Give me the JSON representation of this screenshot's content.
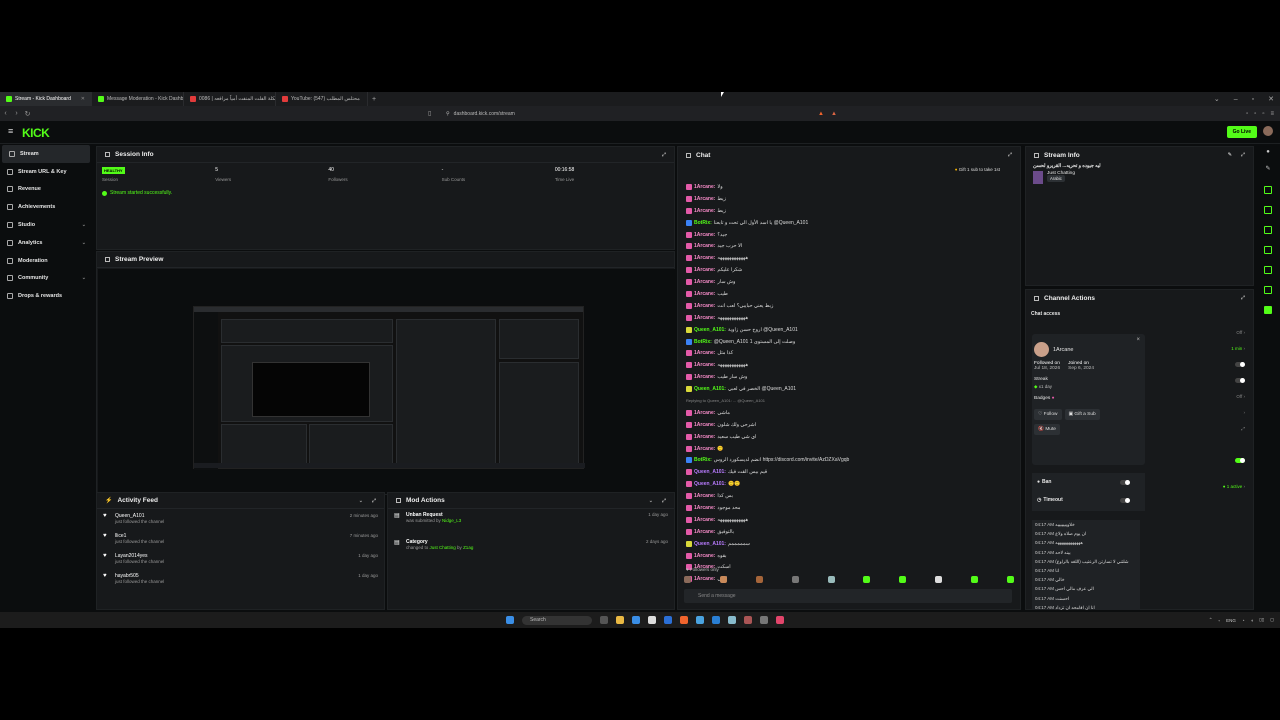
{
  "browser": {
    "tabs": [
      {
        "title": "Stream - Kick Dashboard",
        "color": "#53fc18",
        "active": true
      },
      {
        "title": "Message Moderation - Kick Dashbo…",
        "color": "#53fc18",
        "active": false
      },
      {
        "title": "مشكلة الفلت المنفت أمياً مرافعه | 0086 ...",
        "color": "#e23b3b",
        "active": false
      },
      {
        "title": "YouTube: محتلس المطلب (547)",
        "color": "#e23b3b",
        "active": false
      }
    ],
    "url": "dashboard.kick.com/stream"
  },
  "header": {
    "logo": "KICK",
    "go_live": "Go Live"
  },
  "sidebar": {
    "items": [
      {
        "label": "Stream",
        "chevron": false,
        "active": true
      },
      {
        "label": "Stream URL & Key",
        "chevron": false
      },
      {
        "label": "Revenue",
        "chevron": false
      },
      {
        "label": "Achievements",
        "chevron": false
      },
      {
        "label": "Studio",
        "chevron": true
      },
      {
        "label": "Analytics",
        "chevron": true
      },
      {
        "label": "Moderation",
        "chevron": false
      },
      {
        "label": "Community",
        "chevron": true
      },
      {
        "label": "Drops & rewards",
        "chevron": false
      }
    ]
  },
  "session": {
    "title": "Session Info",
    "status": "HEALTHY",
    "stats": [
      {
        "value": "",
        "label": "Session"
      },
      {
        "value": "5",
        "label": "Viewers"
      },
      {
        "value": "40",
        "label": "Followers"
      },
      {
        "value": "-",
        "label": "Sub Counts"
      },
      {
        "value": "00:16:58",
        "label": "Time Live"
      }
    ],
    "message": "Stream started successfully."
  },
  "preview": {
    "title": "Stream Preview"
  },
  "activity": {
    "title": "Activity Feed",
    "rows": [
      {
        "name": "Queen_A101",
        "sub": "just followed the channel",
        "time": "2 minutes ago"
      },
      {
        "name": "llice1",
        "sub": "just followed the channel",
        "time": "7 minutes ago"
      },
      {
        "name": "Layan2014yes",
        "sub": "just followed the channel",
        "time": "1 day ago"
      },
      {
        "name": "hayabr505",
        "sub": "just followed the channel",
        "time": "1 day ago"
      }
    ]
  },
  "mod": {
    "title": "Mod Actions",
    "rows": [
      {
        "title": "Unban Request",
        "sub": "was submitted by ",
        "who": "Nidge_L3",
        "time": "1 day ago"
      },
      {
        "title": "Category",
        "sub": "changed to ",
        "who": "Just Chatting",
        "by": " by ",
        "who2": "Z1ag",
        "time": "2 days ago"
      }
    ]
  },
  "chat": {
    "title": "Chat",
    "gift": "Gift 1 sub to take 1st",
    "followers_only": "Followers only",
    "placeholder": "Send a message",
    "lines": [
      {
        "n": "1Arcane:",
        "m": "ولا",
        "c": "#f58bc7",
        "b": "#e35aa8"
      },
      {
        "n": "1Arcane:",
        "m": "زيط",
        "c": "#f58bc7",
        "b": "#e35aa8"
      },
      {
        "n": "1Arcane:",
        "m": "زيط",
        "c": "#f58bc7",
        "b": "#e35aa8"
      },
      {
        "n": "BotRix:",
        "m": "يا اسد الأول الي تحت و تابعنا @Queen_A101",
        "c": "#53fc18",
        "b": "#3b82f6"
      },
      {
        "n": "1Arcane:",
        "m": "جيد؟",
        "c": "#f58bc7",
        "b": "#e35aa8"
      },
      {
        "n": "1Arcane:",
        "m": "الا حرب جيد",
        "c": "#f58bc7",
        "b": "#e35aa8"
      },
      {
        "n": "1Arcane:",
        "m": "ههههههههههههه",
        "c": "#f58bc7",
        "b": "#e35aa8"
      },
      {
        "n": "1Arcane:",
        "m": "شكرا عليكم",
        "c": "#f58bc7",
        "b": "#e35aa8"
      },
      {
        "n": "1Arcane:",
        "m": "وش سار",
        "c": "#f58bc7",
        "b": "#e35aa8"
      },
      {
        "n": "1Arcane:",
        "m": "طيب",
        "c": "#f58bc7",
        "b": "#e35aa8"
      },
      {
        "n": "1Arcane:",
        "m": "زبط يعني حبايبي؟ لعب انت",
        "c": "#f58bc7",
        "b": "#e35aa8"
      },
      {
        "n": "1Arcane:",
        "m": "ههههههههههههه",
        "c": "#f58bc7",
        "b": "#e35aa8"
      },
      {
        "n": "Queen_A101:",
        "m": "اروح حسن زاوية @Queen_A101",
        "c": "#53fc18",
        "b": "#d9d93a"
      },
      {
        "n": "BotRix:",
        "m": "@Queen_A101 وصلت إلى المستوى 1",
        "c": "#53fc18",
        "b": "#3b82f6"
      },
      {
        "n": "1Arcane:",
        "m": "كذا مثل",
        "c": "#f58bc7",
        "b": "#e35aa8"
      },
      {
        "n": "1Arcane:",
        "m": "ههههههههههههه",
        "c": "#f58bc7",
        "b": "#e35aa8"
      },
      {
        "n": "1Arcane:",
        "m": "وش سار طيب",
        "c": "#f58bc7",
        "b": "#e35aa8"
      },
      {
        "n": "Queen_A101:",
        "m": "الخصر في لعبي @Queen_A101",
        "c": "#53fc18",
        "b": "#d9d93a"
      },
      {
        "n": "",
        "m": "Replying to Queen_A101: ... @Queen_A101",
        "c": "#999",
        "b": "",
        "reply": true
      },
      {
        "n": "1Arcane:",
        "m": "ماشي",
        "c": "#f58bc7",
        "b": "#e35aa8"
      },
      {
        "n": "1Arcane:",
        "m": "اشرحي ولك شلون",
        "c": "#f58bc7",
        "b": "#e35aa8"
      },
      {
        "n": "1Arcane:",
        "m": "اي شي طيب سعيد",
        "c": "#f58bc7",
        "b": "#e35aa8"
      },
      {
        "n": "1Arcane:",
        "m": "🙂",
        "c": "#f58bc7",
        "b": "#e35aa8"
      },
      {
        "n": "BotRix:",
        "m": "انضم لديسكورد الروس https://discord.com/invite/AzDZXaVgqb",
        "c": "#53fc18",
        "b": "#3b82f6"
      },
      {
        "n": "Queen_A101:",
        "m": "قيم بيس القت فيك",
        "c": "#b97cff",
        "b": "#e35aa8"
      },
      {
        "n": "Queen_A101:",
        "m": "🙂🙂",
        "c": "#b97cff",
        "b": "#e35aa8"
      },
      {
        "n": "1Arcane:",
        "m": "بس كذا",
        "c": "#f58bc7",
        "b": "#e35aa8"
      },
      {
        "n": "1Arcane:",
        "m": "محد موجود",
        "c": "#f58bc7",
        "b": "#e35aa8"
      },
      {
        "n": "1Arcane:",
        "m": "ههههههههههههه",
        "c": "#f58bc7",
        "b": "#e35aa8"
      },
      {
        "n": "1Arcane:",
        "m": "بالتوفيق",
        "c": "#f58bc7",
        "b": "#e35aa8"
      },
      {
        "n": "Queen_A101:",
        "m": "سمممممم",
        "c": "#b97cff",
        "b": "#d9d93a"
      },
      {
        "n": "1Arcane:",
        "m": "بقوه",
        "c": "#f58bc7",
        "b": "#e35aa8"
      },
      {
        "n": "1Arcane:",
        "m": "اسكت",
        "c": "#f58bc7",
        "b": "#e35aa8"
      },
      {
        "n": "1Arcane:",
        "m": "انمي",
        "c": "#f58bc7",
        "b": "#e35aa8"
      }
    ]
  },
  "stream_info": {
    "title": "Stream Info",
    "stream_title": "ليه جيوده و تحريه... القريرو لحسن",
    "category": "Just Chatting",
    "tag": "Arabic"
  },
  "channel_actions": {
    "title": "Channel Actions",
    "chat_access": "Chat access",
    "right_labels": [
      "Off",
      "1 min",
      "",
      "Off"
    ],
    "active_label": "1 active"
  },
  "user_card": {
    "name": "1Arcane",
    "followed_on_label": "Followed on",
    "followed_on": "Jul 18, 2026",
    "joined_on_label": "Joined on",
    "joined_on": "Sep 6, 2024",
    "streak_label": "Streak",
    "streak": "x1 day",
    "badges_label": "Badges",
    "follow": "Follow",
    "gift": "Gift a Sub",
    "mute": "Mute",
    "ban": "Ban",
    "timeout": "Timeout"
  },
  "logs": [
    {
      "t": "04:17 AM",
      "m": "خلاويييييييه"
    },
    {
      "t": "04:17 AM",
      "m": "ان يوم صلاه ولاع"
    },
    {
      "t": "04:17 AM",
      "m": "ههههههههههههه"
    },
    {
      "t": "04:17 AM",
      "m": "بينه لاحه"
    },
    {
      "t": "04:17 AM",
      "m": "شلتني لا تسارتن الرعتيب (اللغه بالراوع)"
    },
    {
      "t": "04:17 AM",
      "m": "انا"
    },
    {
      "t": "04:17 AM",
      "m": "خالي"
    },
    {
      "t": "04:17 AM",
      "m": "الي عرف مالي احس"
    },
    {
      "t": "04:17 AM",
      "m": "احسنت"
    },
    {
      "t": "04:17 AM",
      "m": "انا ان اقامحه ان تزداد"
    }
  ],
  "taskbar": {
    "search": "Search",
    "lang": "ENG"
  }
}
